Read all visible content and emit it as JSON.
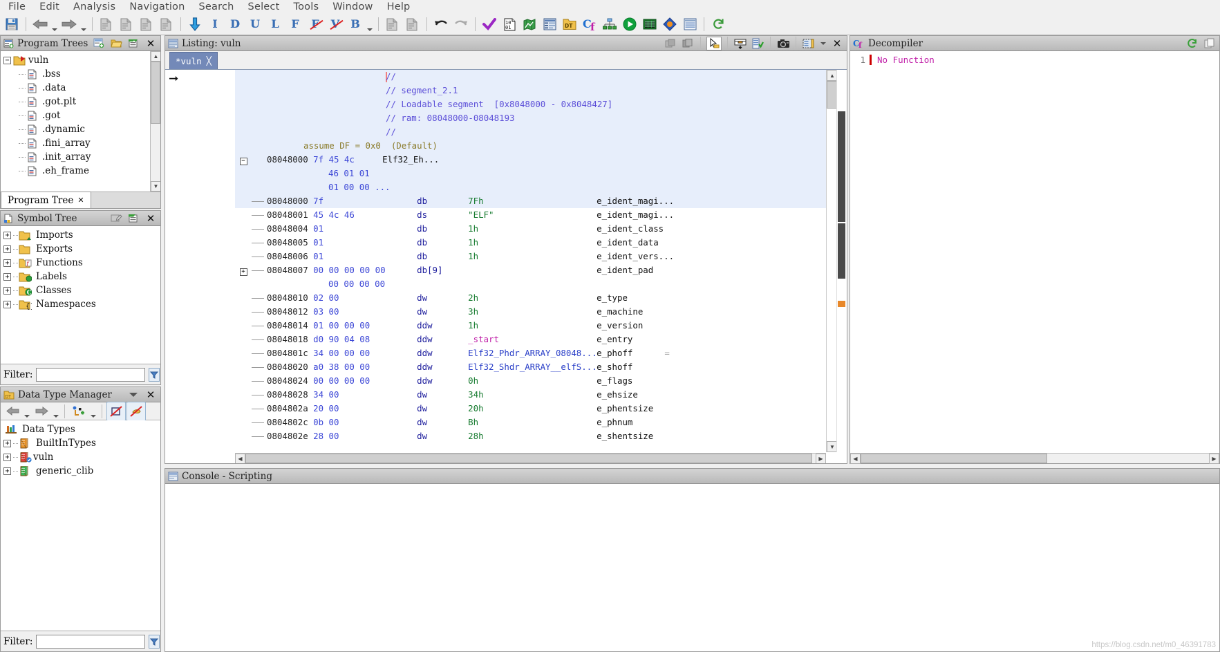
{
  "menu": {
    "items": [
      "File",
      "Edit",
      "Analysis",
      "Navigation",
      "Search",
      "Select",
      "Tools",
      "Window",
      "Help"
    ]
  },
  "toolbar": {
    "groups": [
      [
        {
          "name": "save-icon",
          "glyph": "save"
        }
      ],
      [
        {
          "name": "back-icon",
          "glyph": "arrow-left",
          "dropdown": true
        },
        {
          "name": "forward-icon",
          "glyph": "arrow-right",
          "dropdown": true
        }
      ],
      [
        {
          "name": "copy-page-icon",
          "glyph": "page"
        },
        {
          "name": "open-page-icon",
          "glyph": "page"
        },
        {
          "name": "paste-page-icon",
          "glyph": "page"
        },
        {
          "name": "pages-icon",
          "glyph": "page"
        }
      ],
      [
        {
          "name": "disassemble-icon",
          "glyph": "down-arrow"
        },
        {
          "name": "instruction-icon",
          "glyph": "letter",
          "letter": "I"
        },
        {
          "name": "data-icon",
          "glyph": "letter",
          "letter": "D"
        },
        {
          "name": "undefine-icon",
          "glyph": "letter",
          "letter": "U"
        },
        {
          "name": "label-icon",
          "glyph": "letter",
          "letter": "L"
        },
        {
          "name": "function-icon",
          "glyph": "letter",
          "letter": "F"
        },
        {
          "name": "clear-flow-icon",
          "glyph": "letter-strike",
          "letter": "F"
        },
        {
          "name": "clear-var-icon",
          "glyph": "letter-strike",
          "letter": "V"
        },
        {
          "name": "bookmark-icon",
          "glyph": "letter",
          "letter": "B",
          "dropdown": true
        }
      ],
      [
        {
          "name": "import-icon",
          "glyph": "page"
        },
        {
          "name": "export-icon",
          "glyph": "page"
        }
      ],
      [
        {
          "name": "undo-icon",
          "glyph": "undo"
        },
        {
          "name": "redo-icon",
          "glyph": "redo"
        }
      ],
      [
        {
          "name": "check-icon",
          "glyph": "check"
        },
        {
          "name": "bytes-viewer-icon",
          "glyph": "bytes"
        },
        {
          "name": "memory-map-icon",
          "glyph": "map"
        },
        {
          "name": "listing-icon",
          "glyph": "listing"
        },
        {
          "name": "data-type-manager-icon",
          "glyph": "dt-folder"
        },
        {
          "name": "function-graph-icon",
          "glyph": "cf"
        },
        {
          "name": "call-tree-icon",
          "glyph": "calltree"
        },
        {
          "name": "run-script-icon",
          "glyph": "play"
        },
        {
          "name": "memory-icon",
          "glyph": "chip"
        },
        {
          "name": "diff-icon",
          "glyph": "diamond"
        },
        {
          "name": "table-icon",
          "glyph": "table"
        }
      ],
      [
        {
          "name": "refresh-icon",
          "glyph": "refresh"
        }
      ]
    ]
  },
  "program_trees": {
    "title": "Program Trees",
    "tools": [
      "new-tree-icon",
      "open-folder-icon",
      "collapse-icon",
      "close-icon"
    ],
    "root": "vuln",
    "nodes": [
      ".bss",
      ".data",
      ".got.plt",
      ".got",
      ".dynamic",
      ".fini_array",
      ".init_array",
      ".eh_frame"
    ],
    "tab_label": "Program Tree"
  },
  "symbol_tree": {
    "title": "Symbol Tree",
    "tools": [
      "edit-icon",
      "collapse-icon",
      "close-icon"
    ],
    "nodes": [
      {
        "label": "Imports",
        "icon": "folder-imports-icon"
      },
      {
        "label": "Exports",
        "icon": "folder-exports-icon"
      },
      {
        "label": "Functions",
        "icon": "folder-functions-icon"
      },
      {
        "label": "Labels",
        "icon": "folder-labels-icon"
      },
      {
        "label": "Classes",
        "icon": "folder-classes-icon"
      },
      {
        "label": "Namespaces",
        "icon": "folder-namespaces-icon"
      }
    ],
    "filter_label": "Filter:",
    "filter_value": "",
    "filter_placeholder": ""
  },
  "data_type_manager": {
    "title": "Data Type Manager",
    "tools": [
      "dropdown-icon",
      "close-icon"
    ],
    "toolbar": [
      "back-icon",
      "forward-icon",
      "new-type-icon",
      "filter-off-icon",
      "pointer-off-icon"
    ],
    "root": "Data Types",
    "nodes": [
      {
        "label": "BuiltInTypes",
        "icon": "archive-orange-icon"
      },
      {
        "label": "vuln",
        "icon": "archive-red-icon",
        "checked": true
      },
      {
        "label": "generic_clib",
        "icon": "archive-green-icon"
      }
    ],
    "filter_label": "Filter:",
    "filter_value": ""
  },
  "listing": {
    "title": "Listing:  vuln",
    "tab_label": "*vuln",
    "tools": [
      "snapshot-icon",
      "copy-icon",
      "select-icon",
      "toggle-header-icon",
      "diff-icon",
      "camera-icon",
      "edit-fields-icon",
      "dropdown-icon",
      "close-icon"
    ],
    "lines": [
      {
        "type": "comment",
        "addr": "",
        "bytes": "",
        "text": "//",
        "selected": true,
        "cursor": true
      },
      {
        "type": "comment",
        "addr": "",
        "bytes": "",
        "text": "// segment_2.1",
        "selected": true
      },
      {
        "type": "comment",
        "addr": "",
        "bytes": "",
        "text": "// Loadable segment  [0x8048000 - 0x8048427]",
        "selected": true
      },
      {
        "type": "comment",
        "addr": "",
        "bytes": "",
        "text": "// ram: 08048000-08048193",
        "selected": true
      },
      {
        "type": "comment",
        "addr": "",
        "bytes": "",
        "text": "//",
        "selected": true
      },
      {
        "type": "assume",
        "text": "assume DF = 0x0  (Default)",
        "selected": true
      },
      {
        "type": "struct",
        "collapse": "-",
        "addr": "08048000",
        "bytes": "7f 45 4c",
        "mnemonic": "",
        "value": "Elf32_Eh...",
        "field": "",
        "selected": true
      },
      {
        "type": "cont",
        "addr": "",
        "bytes": "46 01 01",
        "selected": true
      },
      {
        "type": "cont",
        "addr": "",
        "bytes": "01 00 00 ...",
        "selected": true
      },
      {
        "type": "data",
        "addr": "08048000",
        "bytes": "7f",
        "mnemonic": "db",
        "value": "7Fh",
        "field": "e_ident_magi...",
        "selected": true
      },
      {
        "type": "data",
        "addr": "08048001",
        "bytes": "45 4c 46",
        "mnemonic": "ds",
        "value": "\"ELF\"",
        "valkind": "str",
        "field": "e_ident_magi..."
      },
      {
        "type": "data",
        "addr": "08048004",
        "bytes": "01",
        "mnemonic": "db",
        "value": "1h",
        "field": "e_ident_class"
      },
      {
        "type": "data",
        "addr": "08048005",
        "bytes": "01",
        "mnemonic": "db",
        "value": "1h",
        "field": "e_ident_data"
      },
      {
        "type": "data",
        "addr": "08048006",
        "bytes": "01",
        "mnemonic": "db",
        "value": "1h",
        "field": "e_ident_vers..."
      },
      {
        "type": "data",
        "collapse": "+",
        "addr": "08048007",
        "bytes": "00 00 00 00 00",
        "mnemonic": "db[9]",
        "value": "",
        "field": "e_ident_pad"
      },
      {
        "type": "cont",
        "addr": "",
        "bytes": "00 00 00 00"
      },
      {
        "type": "data",
        "addr": "08048010",
        "bytes": "02 00",
        "mnemonic": "dw",
        "value": "2h",
        "field": "e_type"
      },
      {
        "type": "data",
        "addr": "08048012",
        "bytes": "03 00",
        "mnemonic": "dw",
        "value": "3h",
        "field": "e_machine"
      },
      {
        "type": "data",
        "addr": "08048014",
        "bytes": "01 00 00 00",
        "mnemonic": "ddw",
        "value": "1h",
        "field": "e_version"
      },
      {
        "type": "data",
        "addr": "08048018",
        "bytes": "d0 90 04 08",
        "mnemonic": "ddw",
        "value": "_start",
        "valkind": "label",
        "field": "e_entry"
      },
      {
        "type": "data",
        "addr": "0804801c",
        "bytes": "34 00 00 00",
        "mnemonic": "ddw",
        "value": "Elf32_Phdr_ARRAY_08048...",
        "valkind": "ref",
        "field": "e_phoff",
        "marker": "="
      },
      {
        "type": "data",
        "addr": "08048020",
        "bytes": "a0 38 00 00",
        "mnemonic": "ddw",
        "value": "Elf32_Shdr_ARRAY__elfS...",
        "valkind": "ref",
        "field": "e_shoff"
      },
      {
        "type": "data",
        "addr": "08048024",
        "bytes": "00 00 00 00",
        "mnemonic": "ddw",
        "value": "0h",
        "field": "e_flags"
      },
      {
        "type": "data",
        "addr": "08048028",
        "bytes": "34 00",
        "mnemonic": "dw",
        "value": "34h",
        "field": "e_ehsize"
      },
      {
        "type": "data",
        "addr": "0804802a",
        "bytes": "20 00",
        "mnemonic": "dw",
        "value": "20h",
        "field": "e_phentsize"
      },
      {
        "type": "data",
        "addr": "0804802c",
        "bytes": "0b 00",
        "mnemonic": "dw",
        "value": "Bh",
        "field": "e_phnum"
      },
      {
        "type": "data",
        "addr": "0804802e",
        "bytes": "28 00",
        "mnemonic": "dw",
        "value": "28h",
        "field": "e_shentsize"
      }
    ]
  },
  "decompiler": {
    "title": "Decompiler",
    "tools": [
      "refresh-icon",
      "copy-icon"
    ],
    "line_number": "1",
    "text": "No Function"
  },
  "console": {
    "title": "Console - Scripting",
    "content": ""
  },
  "watermark": "https://blog.csdn.net/m0_46391783",
  "colors": {
    "accent": "#7389b8",
    "selection": "#e7eefb",
    "comment": "#5c4fd8",
    "value": "#157a2e",
    "label": "#c01fa8",
    "byte": "#3b46d6"
  }
}
